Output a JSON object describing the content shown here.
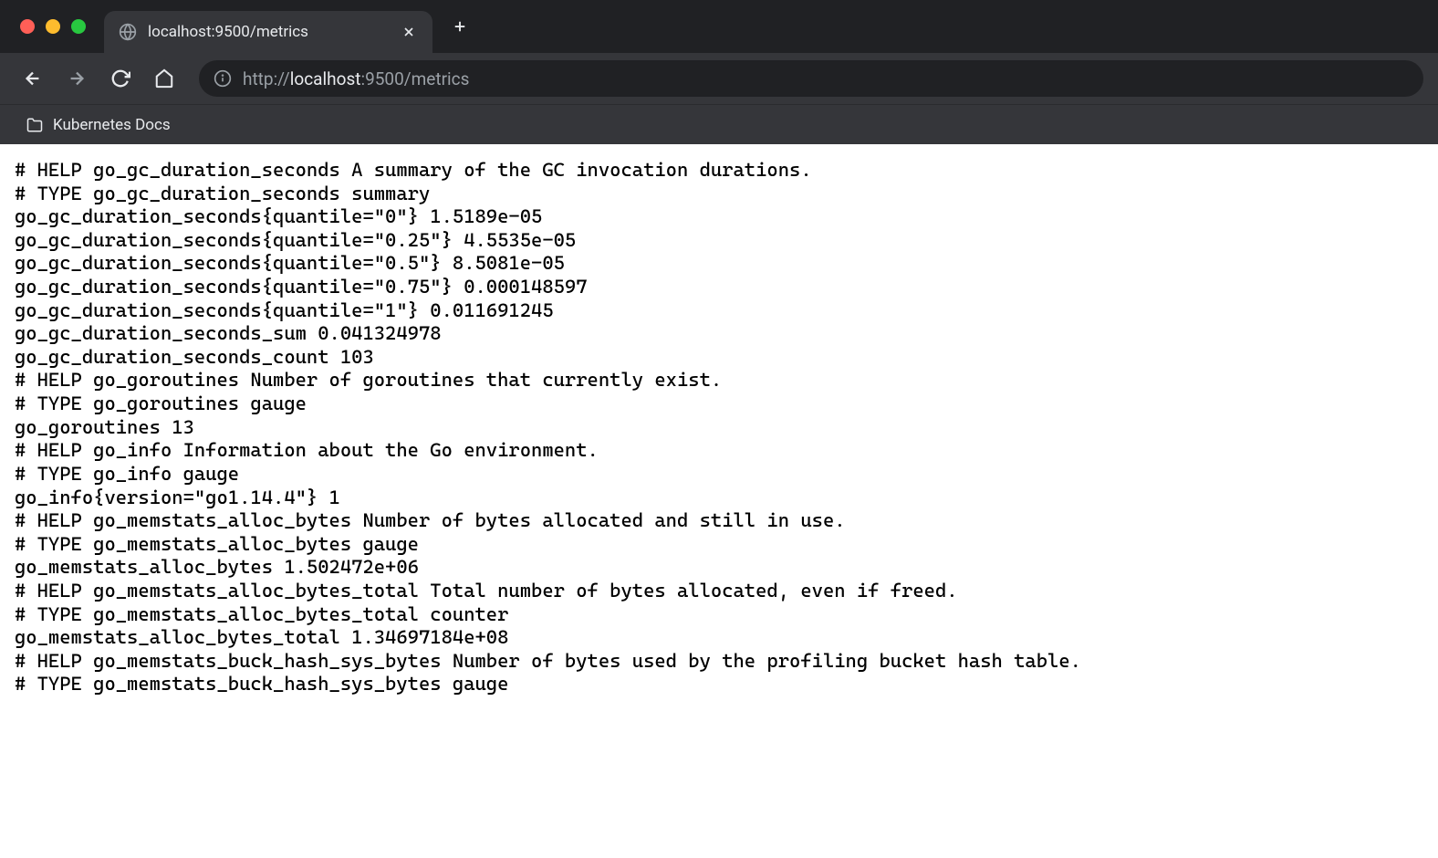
{
  "tab": {
    "title": "localhost:9500/metrics"
  },
  "url": {
    "scheme": "http://",
    "host": "localhost",
    "port_path": ":9500/metrics"
  },
  "bookmarks": [
    {
      "label": "Kubernetes Docs"
    }
  ],
  "metrics_lines": [
    "# HELP go_gc_duration_seconds A summary of the GC invocation durations.",
    "# TYPE go_gc_duration_seconds summary",
    "go_gc_duration_seconds{quantile=\"0\"} 1.5189e-05",
    "go_gc_duration_seconds{quantile=\"0.25\"} 4.5535e-05",
    "go_gc_duration_seconds{quantile=\"0.5\"} 8.5081e-05",
    "go_gc_duration_seconds{quantile=\"0.75\"} 0.000148597",
    "go_gc_duration_seconds{quantile=\"1\"} 0.011691245",
    "go_gc_duration_seconds_sum 0.041324978",
    "go_gc_duration_seconds_count 103",
    "# HELP go_goroutines Number of goroutines that currently exist.",
    "# TYPE go_goroutines gauge",
    "go_goroutines 13",
    "# HELP go_info Information about the Go environment.",
    "# TYPE go_info gauge",
    "go_info{version=\"go1.14.4\"} 1",
    "# HELP go_memstats_alloc_bytes Number of bytes allocated and still in use.",
    "# TYPE go_memstats_alloc_bytes gauge",
    "go_memstats_alloc_bytes 1.502472e+06",
    "# HELP go_memstats_alloc_bytes_total Total number of bytes allocated, even if freed.",
    "# TYPE go_memstats_alloc_bytes_total counter",
    "go_memstats_alloc_bytes_total 1.34697184e+08",
    "# HELP go_memstats_buck_hash_sys_bytes Number of bytes used by the profiling bucket hash table.",
    "# TYPE go_memstats_buck_hash_sys_bytes gauge"
  ]
}
